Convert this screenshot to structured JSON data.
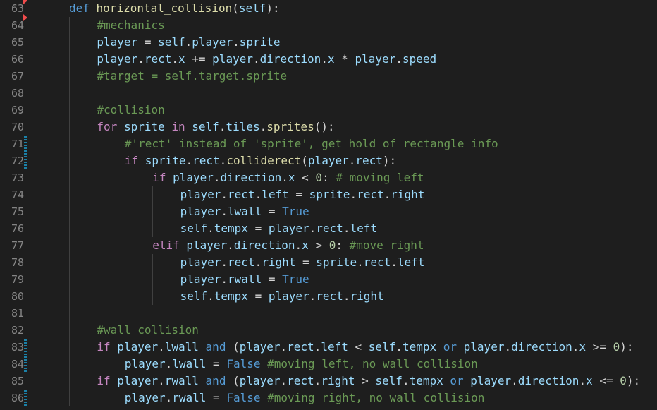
{
  "editor": {
    "lines": [
      {
        "n": "63",
        "indent": 1,
        "mark": "del",
        "tokens": [
          [
            "def",
            "def"
          ],
          [
            " ",
            "op"
          ],
          [
            "horizontal_collision",
            "fn"
          ],
          [
            "(",
            "punc"
          ],
          [
            "self",
            "self"
          ],
          [
            "):",
            "punc"
          ]
        ]
      },
      {
        "n": "64",
        "indent": 2,
        "mark": "del",
        "tokens": [
          [
            "#mechanics",
            "cm"
          ]
        ]
      },
      {
        "n": "65",
        "indent": 2,
        "mark": "",
        "tokens": [
          [
            "player",
            "var"
          ],
          [
            " = ",
            "op"
          ],
          [
            "self",
            "self"
          ],
          [
            ".",
            "op"
          ],
          [
            "player",
            "var"
          ],
          [
            ".",
            "op"
          ],
          [
            "sprite",
            "var"
          ]
        ]
      },
      {
        "n": "66",
        "indent": 2,
        "mark": "",
        "tokens": [
          [
            "player",
            "var"
          ],
          [
            ".",
            "op"
          ],
          [
            "rect",
            "var"
          ],
          [
            ".",
            "op"
          ],
          [
            "x",
            "var"
          ],
          [
            " += ",
            "op"
          ],
          [
            "player",
            "var"
          ],
          [
            ".",
            "op"
          ],
          [
            "direction",
            "var"
          ],
          [
            ".",
            "op"
          ],
          [
            "x",
            "var"
          ],
          [
            " * ",
            "op"
          ],
          [
            "player",
            "var"
          ],
          [
            ".",
            "op"
          ],
          [
            "speed",
            "var"
          ]
        ]
      },
      {
        "n": "67",
        "indent": 2,
        "mark": "",
        "tokens": [
          [
            "#target = self.target.sprite",
            "cm"
          ]
        ]
      },
      {
        "n": "68",
        "indent": 2,
        "mark": "",
        "tokens": []
      },
      {
        "n": "69",
        "indent": 2,
        "mark": "",
        "tokens": [
          [
            "#collision",
            "cm"
          ]
        ]
      },
      {
        "n": "70",
        "indent": 2,
        "mark": "",
        "tokens": [
          [
            "for",
            "kw"
          ],
          [
            " ",
            "op"
          ],
          [
            "sprite",
            "var"
          ],
          [
            " ",
            "op"
          ],
          [
            "in",
            "kw"
          ],
          [
            " ",
            "op"
          ],
          [
            "self",
            "self"
          ],
          [
            ".",
            "op"
          ],
          [
            "tiles",
            "var"
          ],
          [
            ".",
            "op"
          ],
          [
            "sprites",
            "fn"
          ],
          [
            "():",
            "punc"
          ]
        ]
      },
      {
        "n": "71",
        "indent": 3,
        "mark": "mod",
        "tokens": [
          [
            "#'rect' instead of 'sprite', get hold of rectangle info",
            "cm"
          ]
        ]
      },
      {
        "n": "72",
        "indent": 3,
        "mark": "mod",
        "tokens": [
          [
            "if",
            "kw"
          ],
          [
            " ",
            "op"
          ],
          [
            "sprite",
            "var"
          ],
          [
            ".",
            "op"
          ],
          [
            "rect",
            "var"
          ],
          [
            ".",
            "op"
          ],
          [
            "colliderect",
            "fn"
          ],
          [
            "(",
            "punc"
          ],
          [
            "player",
            "var"
          ],
          [
            ".",
            "op"
          ],
          [
            "rect",
            "var"
          ],
          [
            "):",
            "punc"
          ]
        ]
      },
      {
        "n": "73",
        "indent": 4,
        "mark": "",
        "tokens": [
          [
            "if",
            "kw"
          ],
          [
            " ",
            "op"
          ],
          [
            "player",
            "var"
          ],
          [
            ".",
            "op"
          ],
          [
            "direction",
            "var"
          ],
          [
            ".",
            "op"
          ],
          [
            "x",
            "var"
          ],
          [
            " < ",
            "op"
          ],
          [
            "0",
            "num"
          ],
          [
            ": ",
            "op"
          ],
          [
            "# moving left",
            "cm"
          ]
        ]
      },
      {
        "n": "74",
        "indent": 5,
        "mark": "",
        "tokens": [
          [
            "player",
            "var"
          ],
          [
            ".",
            "op"
          ],
          [
            "rect",
            "var"
          ],
          [
            ".",
            "op"
          ],
          [
            "left",
            "var"
          ],
          [
            " = ",
            "op"
          ],
          [
            "sprite",
            "var"
          ],
          [
            ".",
            "op"
          ],
          [
            "rect",
            "var"
          ],
          [
            ".",
            "op"
          ],
          [
            "right",
            "var"
          ]
        ]
      },
      {
        "n": "75",
        "indent": 5,
        "mark": "",
        "tokens": [
          [
            "player",
            "var"
          ],
          [
            ".",
            "op"
          ],
          [
            "lwall",
            "var"
          ],
          [
            " = ",
            "op"
          ],
          [
            "True",
            "const"
          ]
        ]
      },
      {
        "n": "76",
        "indent": 5,
        "mark": "",
        "tokens": [
          [
            "self",
            "self"
          ],
          [
            ".",
            "op"
          ],
          [
            "tempx",
            "var"
          ],
          [
            " = ",
            "op"
          ],
          [
            "player",
            "var"
          ],
          [
            ".",
            "op"
          ],
          [
            "rect",
            "var"
          ],
          [
            ".",
            "op"
          ],
          [
            "left",
            "var"
          ]
        ]
      },
      {
        "n": "77",
        "indent": 4,
        "mark": "",
        "tokens": [
          [
            "elif",
            "kw"
          ],
          [
            " ",
            "op"
          ],
          [
            "player",
            "var"
          ],
          [
            ".",
            "op"
          ],
          [
            "direction",
            "var"
          ],
          [
            ".",
            "op"
          ],
          [
            "x",
            "var"
          ],
          [
            " > ",
            "op"
          ],
          [
            "0",
            "num"
          ],
          [
            ": ",
            "op"
          ],
          [
            "#move right",
            "cm"
          ]
        ]
      },
      {
        "n": "78",
        "indent": 5,
        "mark": "",
        "tokens": [
          [
            "player",
            "var"
          ],
          [
            ".",
            "op"
          ],
          [
            "rect",
            "var"
          ],
          [
            ".",
            "op"
          ],
          [
            "right",
            "var"
          ],
          [
            " = ",
            "op"
          ],
          [
            "sprite",
            "var"
          ],
          [
            ".",
            "op"
          ],
          [
            "rect",
            "var"
          ],
          [
            ".",
            "op"
          ],
          [
            "left",
            "var"
          ]
        ]
      },
      {
        "n": "79",
        "indent": 5,
        "mark": "",
        "tokens": [
          [
            "player",
            "var"
          ],
          [
            ".",
            "op"
          ],
          [
            "rwall",
            "var"
          ],
          [
            " = ",
            "op"
          ],
          [
            "True",
            "const"
          ]
        ]
      },
      {
        "n": "80",
        "indent": 5,
        "mark": "",
        "tokens": [
          [
            "self",
            "self"
          ],
          [
            ".",
            "op"
          ],
          [
            "tempx",
            "var"
          ],
          [
            " = ",
            "op"
          ],
          [
            "player",
            "var"
          ],
          [
            ".",
            "op"
          ],
          [
            "rect",
            "var"
          ],
          [
            ".",
            "op"
          ],
          [
            "right",
            "var"
          ]
        ]
      },
      {
        "n": "81",
        "indent": 2,
        "mark": "",
        "tokens": []
      },
      {
        "n": "82",
        "indent": 2,
        "mark": "",
        "tokens": [
          [
            "#wall collision",
            "cm"
          ]
        ]
      },
      {
        "n": "83",
        "indent": 2,
        "mark": "mod",
        "tokens": [
          [
            "if",
            "kw"
          ],
          [
            " ",
            "op"
          ],
          [
            "player",
            "var"
          ],
          [
            ".",
            "op"
          ],
          [
            "lwall",
            "var"
          ],
          [
            " ",
            "op"
          ],
          [
            "and",
            "def"
          ],
          [
            " (",
            "punc"
          ],
          [
            "player",
            "var"
          ],
          [
            ".",
            "op"
          ],
          [
            "rect",
            "var"
          ],
          [
            ".",
            "op"
          ],
          [
            "left",
            "var"
          ],
          [
            " < ",
            "op"
          ],
          [
            "self",
            "self"
          ],
          [
            ".",
            "op"
          ],
          [
            "tempx",
            "var"
          ],
          [
            " ",
            "op"
          ],
          [
            "or",
            "def"
          ],
          [
            " ",
            "op"
          ],
          [
            "player",
            "var"
          ],
          [
            ".",
            "op"
          ],
          [
            "direction",
            "var"
          ],
          [
            ".",
            "op"
          ],
          [
            "x",
            "var"
          ],
          [
            " >= ",
            "op"
          ],
          [
            "0",
            "num"
          ],
          [
            "):",
            "punc"
          ]
        ]
      },
      {
        "n": "84",
        "indent": 3,
        "mark": "mod",
        "tokens": [
          [
            "player",
            "var"
          ],
          [
            ".",
            "op"
          ],
          [
            "lwall",
            "var"
          ],
          [
            " = ",
            "op"
          ],
          [
            "False",
            "const"
          ],
          [
            " ",
            "op"
          ],
          [
            "#moving left, no wall collision",
            "cm"
          ]
        ]
      },
      {
        "n": "85",
        "indent": 2,
        "mark": "",
        "tokens": [
          [
            "if",
            "kw"
          ],
          [
            " ",
            "op"
          ],
          [
            "player",
            "var"
          ],
          [
            ".",
            "op"
          ],
          [
            "rwall",
            "var"
          ],
          [
            " ",
            "op"
          ],
          [
            "and",
            "def"
          ],
          [
            " (",
            "punc"
          ],
          [
            "player",
            "var"
          ],
          [
            ".",
            "op"
          ],
          [
            "rect",
            "var"
          ],
          [
            ".",
            "op"
          ],
          [
            "right",
            "var"
          ],
          [
            " > ",
            "op"
          ],
          [
            "self",
            "self"
          ],
          [
            ".",
            "op"
          ],
          [
            "tempx",
            "var"
          ],
          [
            " ",
            "op"
          ],
          [
            "or",
            "def"
          ],
          [
            " ",
            "op"
          ],
          [
            "player",
            "var"
          ],
          [
            ".",
            "op"
          ],
          [
            "direction",
            "var"
          ],
          [
            ".",
            "op"
          ],
          [
            "x",
            "var"
          ],
          [
            " <= ",
            "op"
          ],
          [
            "0",
            "num"
          ],
          [
            "):",
            "punc"
          ]
        ]
      },
      {
        "n": "86",
        "indent": 3,
        "mark": "mod",
        "tokens": [
          [
            "player",
            "var"
          ],
          [
            ".",
            "op"
          ],
          [
            "rwall",
            "var"
          ],
          [
            " = ",
            "op"
          ],
          [
            "False",
            "const"
          ],
          [
            " ",
            "op"
          ],
          [
            "#moving right, no wall collision",
            "cm"
          ]
        ]
      }
    ]
  }
}
